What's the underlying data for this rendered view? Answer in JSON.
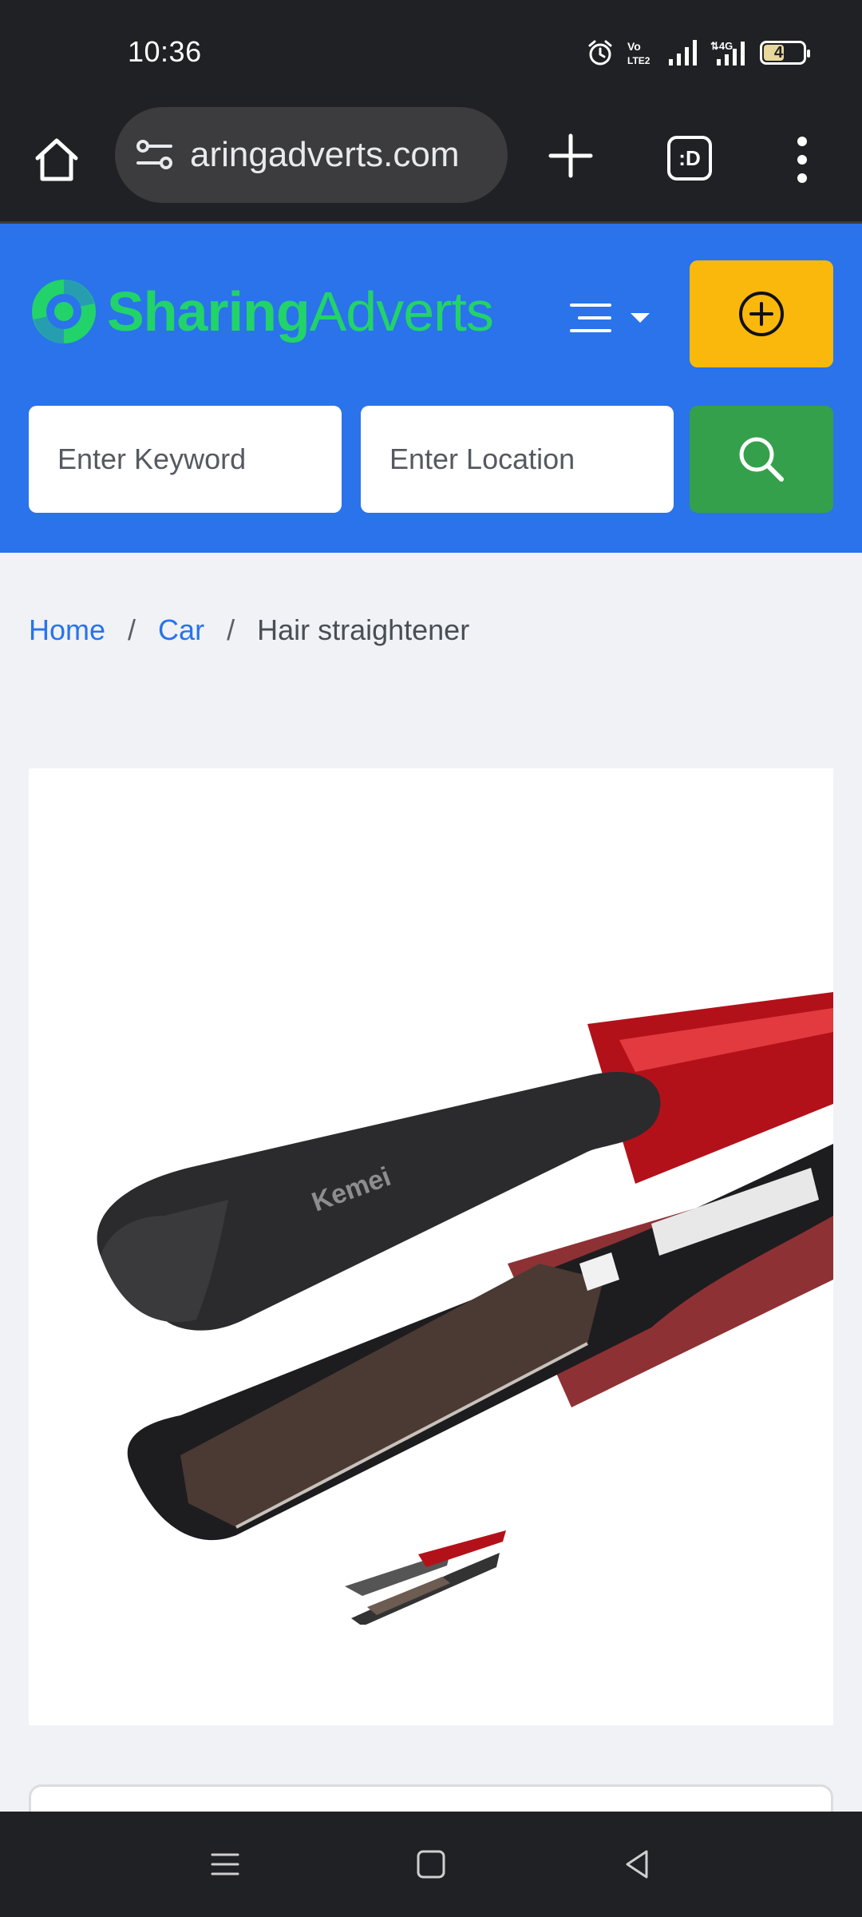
{
  "status_bar": {
    "time": "10:36",
    "battery_level": "48",
    "icons": [
      "alarm-icon",
      "volte-icon",
      "signal-icon",
      "4g-signal-icon",
      "battery-icon"
    ]
  },
  "browser": {
    "url": "aringadverts.com",
    "tab_switcher_label": ":D",
    "icons": [
      "home-icon",
      "site-settings-icon",
      "new-tab-icon",
      "tab-switcher-icon",
      "more-menu-icon"
    ]
  },
  "site": {
    "logo": {
      "strong": "Sharing",
      "light": "Adverts"
    },
    "brand_colors": {
      "header": "#2a73ea",
      "logo": "#22d36a",
      "post_button": "#fbb80c",
      "search_button": "#34a04b"
    },
    "search": {
      "keyword_placeholder": "Enter Keyword",
      "location_placeholder": "Enter Location"
    }
  },
  "breadcrumb": {
    "items": [
      "Home",
      "Car"
    ],
    "current": "Hair straightener",
    "separator": "/"
  },
  "product_image": {
    "brand_text": "Kemei",
    "subject": "hair-straightener-image"
  },
  "system_nav": {
    "icons": [
      "recents-icon",
      "home-square-icon",
      "back-icon"
    ]
  }
}
